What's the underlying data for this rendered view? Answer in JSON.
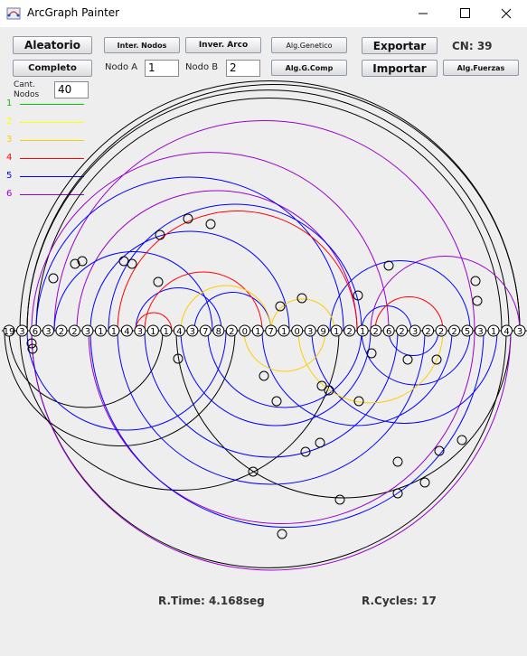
{
  "window": {
    "title": "ArcGraph Painter"
  },
  "toolbar": {
    "aleatorio": "Aleatorio",
    "completo": "Completo",
    "inter_nodos": "Inter. Nodos",
    "inver_arco": "Inver. Arco",
    "alg_genetico": "Alg.Genetico",
    "alg_g_comp": "Alg.G.Comp",
    "exportar": "Exportar",
    "importar": "Importar",
    "alg_fuerzas": "Alg.Fuerzas",
    "cn_label": "CN: 39"
  },
  "fields": {
    "nodo_a_label": "Nodo A",
    "nodo_a_value": "1",
    "nodo_b_label": "Nodo B",
    "nodo_b_value": "2",
    "cant_label_1": "Cant.",
    "cant_label_2": "Nodos",
    "cant_value": "40"
  },
  "legend": [
    {
      "label": "1",
      "color": "#00cc00"
    },
    {
      "label": "2",
      "color": "#ffff00"
    },
    {
      "label": "3",
      "color": "#ffcc00"
    },
    {
      "label": "4",
      "color": "#ff0000"
    },
    {
      "label": "5",
      "color": "#0000ff"
    },
    {
      "label": "6",
      "color": "#9900cc"
    }
  ],
  "graph": {
    "nodes": [
      "19",
      "3",
      "6",
      "3",
      "2",
      "2",
      "3",
      "1",
      "1",
      "4",
      "3",
      "1",
      "1",
      "4",
      "3",
      "7",
      "8",
      "2",
      "0",
      "1",
      "7",
      "1",
      "0",
      "3",
      "9",
      "1",
      "2",
      "1",
      "2",
      "6",
      "2",
      "3",
      "2",
      "2",
      "2",
      "5",
      "3",
      "1",
      "4",
      "3"
    ]
  },
  "status": {
    "runtime": "R.Time: 4.168seg",
    "cycles": "R.Cycles: 17"
  }
}
